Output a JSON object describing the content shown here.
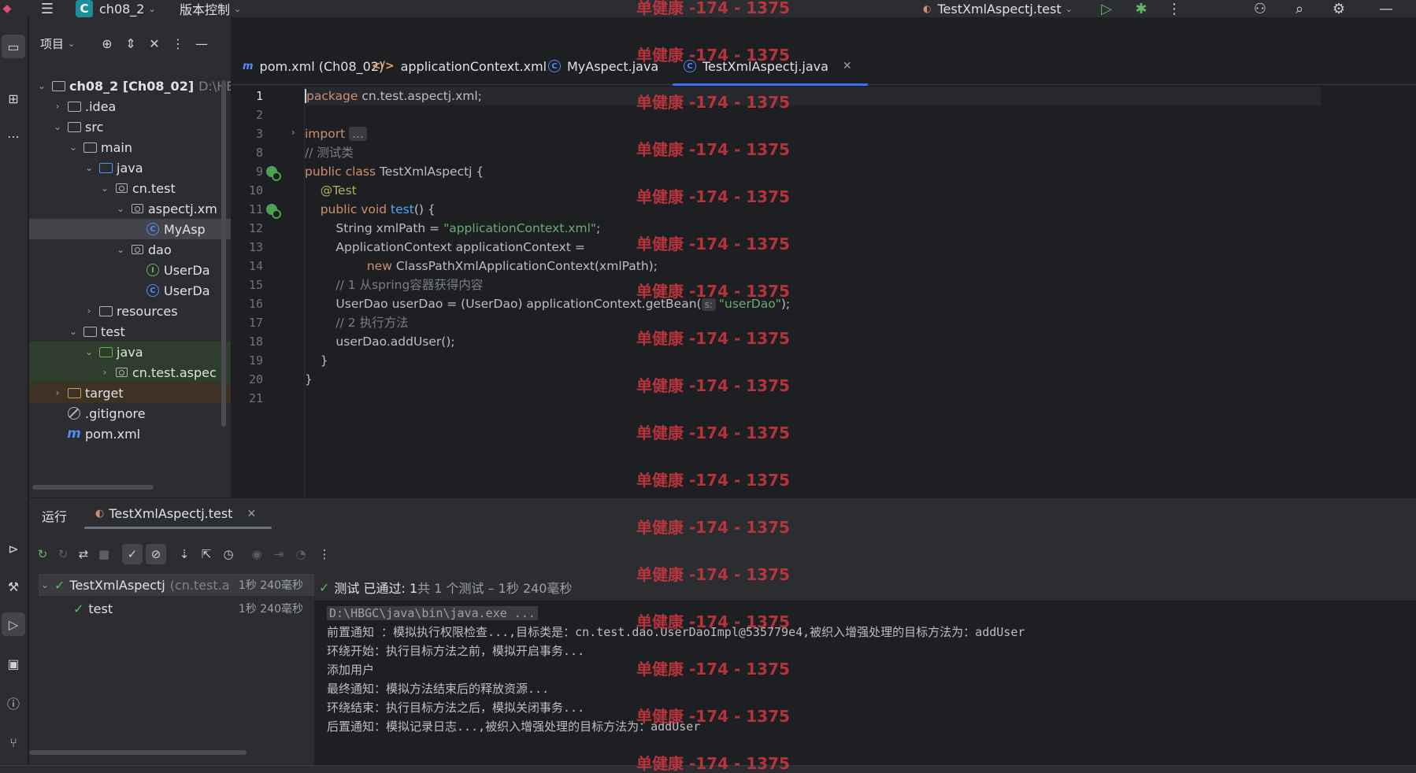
{
  "titlebar": {
    "project_badge": "C",
    "project_name": "ch08_2",
    "vcs_label": "版本控制",
    "run_config": "TestXmlAspectj.test"
  },
  "project_panel": {
    "title": "项目",
    "tree": [
      {
        "label": "ch08_2 [Ch08_02]",
        "suffix": "D:\\HB",
        "depth": 0,
        "arrow": "open",
        "icon": "module"
      },
      {
        "label": ".idea",
        "depth": 1,
        "arrow": "closed",
        "icon": "folder"
      },
      {
        "label": "src",
        "depth": 1,
        "arrow": "open",
        "icon": "folder"
      },
      {
        "label": "main",
        "depth": 2,
        "arrow": "open",
        "icon": "folder"
      },
      {
        "label": "java",
        "depth": 3,
        "arrow": "open",
        "icon": "folder-blue"
      },
      {
        "label": "cn.test",
        "depth": 4,
        "arrow": "open",
        "icon": "package"
      },
      {
        "label": "aspectj.xm",
        "depth": 5,
        "arrow": "open",
        "icon": "package"
      },
      {
        "label": "MyAsp",
        "depth": 6,
        "arrow": "",
        "icon": "class",
        "state": "selected"
      },
      {
        "label": "dao",
        "depth": 5,
        "arrow": "open",
        "icon": "package"
      },
      {
        "label": "UserDa",
        "depth": 6,
        "arrow": "",
        "icon": "interface"
      },
      {
        "label": "UserDa",
        "depth": 6,
        "arrow": "",
        "icon": "class"
      },
      {
        "label": "resources",
        "depth": 3,
        "arrow": "closed",
        "icon": "folder-res"
      },
      {
        "label": "test",
        "depth": 2,
        "arrow": "open",
        "icon": "folder"
      },
      {
        "label": "java",
        "depth": 3,
        "arrow": "open",
        "icon": "folder-green",
        "state": "green"
      },
      {
        "label": "cn.test.aspec",
        "depth": 4,
        "arrow": "closed",
        "icon": "package",
        "state": "green"
      },
      {
        "label": "target",
        "depth": 1,
        "arrow": "closed",
        "icon": "folder-orange",
        "state": "orange"
      },
      {
        "label": ".gitignore",
        "depth": 1,
        "arrow": "",
        "icon": "ignore"
      },
      {
        "label": "pom.xml",
        "depth": 1,
        "arrow": "",
        "icon": "maven"
      }
    ]
  },
  "editor": {
    "tabs": [
      {
        "label": "pom.xml (Ch08_02)",
        "icon": "maven"
      },
      {
        "label": "applicationContext.xml",
        "icon": "xml"
      },
      {
        "label": "MyAspect.java",
        "icon": "class"
      },
      {
        "label": "TestXmlAspectj.java",
        "icon": "class",
        "active": true
      }
    ],
    "line_numbers": [
      "1",
      "2",
      "3",
      "8",
      "9",
      "10",
      "11",
      "12",
      "13",
      "14",
      "15",
      "16",
      "17",
      "18",
      "19",
      "20",
      "21"
    ],
    "code": {
      "l1_kw": "package",
      "l1_rest": " cn.test.aspectj.xml;",
      "l3_kw": "import",
      "l3_fold": "...",
      "l8_cmt": "// 测试类",
      "l9_kw": "public class",
      "l9_rest": " TestXmlAspectj {",
      "l10_ann": "@Test",
      "l11_kw": "public void",
      "l11_fn": "test",
      "l11_rest": "() {",
      "l12_a": "String xmlPath = ",
      "l12_str": "\"applicationContext.xml\"",
      "l12_b": ";",
      "l13": "ApplicationContext applicationContext =",
      "l14_kw": "new",
      "l14_rest": " ClassPathXmlApplicationContext(xmlPath);",
      "l15_cmt": "// 1 从spring容器获得内容",
      "l16_a": "UserDao userDao = (UserDao) applicationContext.getBean(",
      "l16_hint": "s:",
      "l16_str": "\"userDao\"",
      "l16_b": ");",
      "l17_cmt": "// 2 执行方法",
      "l18": "userDao.addUser();",
      "l19": "}",
      "l20": "}"
    }
  },
  "run_panel": {
    "title": "运行",
    "tab_label": "TestXmlAspectj.test",
    "tests": [
      {
        "name": "TestXmlAspectj",
        "detail": "(cn.test.a",
        "duration": "1秒 240毫秒"
      },
      {
        "name": "test",
        "detail": "",
        "duration": "1秒 240毫秒"
      }
    ],
    "status_passed": "测试 已通过: 1",
    "status_detail": "共 1 个测试 – 1秒 240毫秒",
    "console": [
      "D:\\HBGC\\java\\bin\\java.exe ...",
      "前置通知 ：模拟执行权限检查...,目标类是：cn.test.dao.UserDaoImpl@535779e4,被织入增强处理的目标方法为：addUser",
      "环绕开始：执行目标方法之前，模拟开启事务...",
      "添加用户",
      "最终通知：模拟方法结束后的释放资源...",
      "环绕结束：执行目标方法之后，模拟关闭事务...",
      "后置通知：模拟记录日志...,被织入增强处理的目标方法为：addUser"
    ]
  },
  "watermark": "单健康 -174 - 1375",
  "colors": {
    "accent": "#3574f0",
    "pass": "#5fb867",
    "watermark": "#c5373d"
  }
}
